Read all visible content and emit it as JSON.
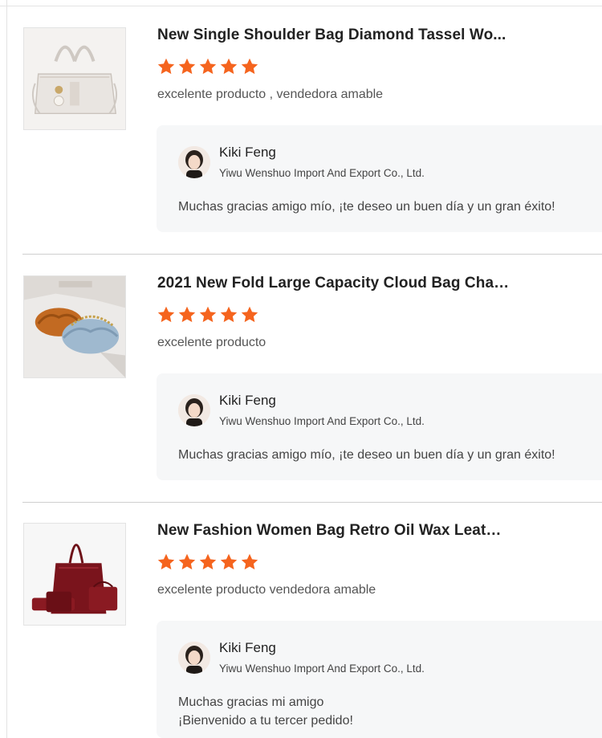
{
  "reviews": [
    {
      "product_title": "New Single Shoulder Bag Diamond Tassel Wo...",
      "product_image": "white-handbag",
      "rating": 5,
      "max_rating": 5,
      "comment": "excelente producto , vendedora amable",
      "reply": {
        "seller_name": "Kiki Feng",
        "company": "Yiwu Wenshuo Import And Export Co., Ltd.",
        "lines": [
          "Muchas gracias amigo mío, ¡te deseo un buen día y un gran éxito!"
        ]
      }
    },
    {
      "product_title": "2021 New Fold Large Capacity Cloud Bag Chai...",
      "product_image": "cloud-bags-orange-blue",
      "rating": 5,
      "max_rating": 5,
      "comment": "excelente producto",
      "reply": {
        "seller_name": "Kiki Feng",
        "company": "Yiwu Wenshuo Import And Export Co., Ltd.",
        "lines": [
          "Muchas gracias amigo mío, ¡te deseo un buen día y un gran éxito!"
        ]
      }
    },
    {
      "product_title": "New Fashion Women Bag Retro Oil Wax Leathe...",
      "product_image": "burgundy-bag-set",
      "rating": 5,
      "max_rating": 5,
      "comment": "excelente producto vendedora amable",
      "reply": {
        "seller_name": "Kiki Feng",
        "company": "Yiwu Wenshuo Import And Export Co., Ltd.",
        "lines": [
          "Muchas gracias mi amigo",
          "¡Bienvenido a tu tercer pedido!"
        ]
      }
    }
  ],
  "colors": {
    "star": "#f5641e",
    "reply_bg": "#f6f7f8",
    "separator": "#cfcfcf"
  },
  "icons": {
    "star": "star-icon"
  }
}
